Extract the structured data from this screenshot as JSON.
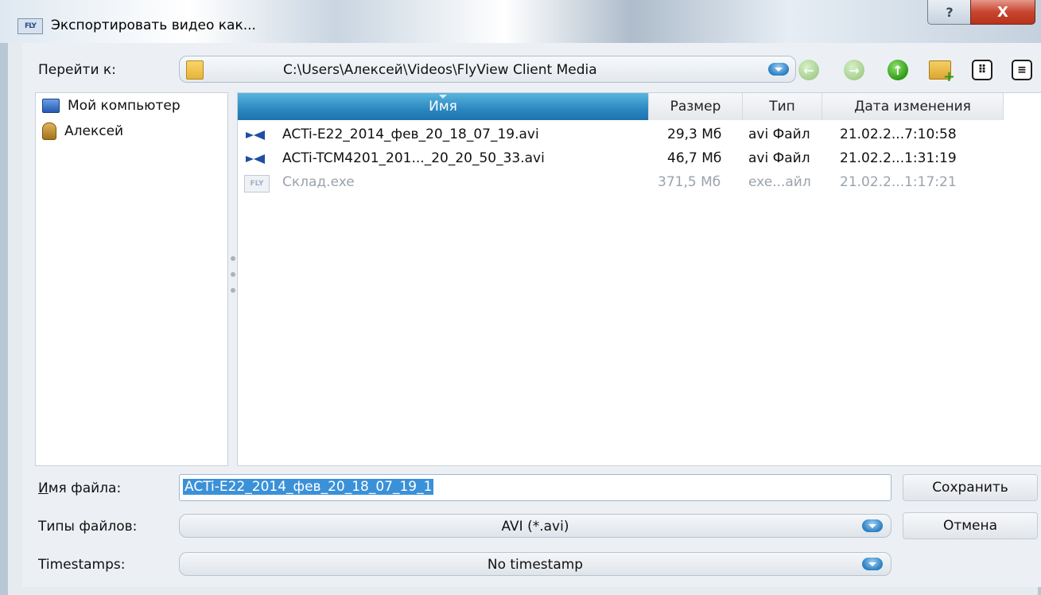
{
  "window": {
    "title": "Экспортировать видео как...",
    "logo_text": "FLY",
    "help_symbol": "?",
    "close_symbol": "X"
  },
  "navigation": {
    "goto_label": "Перейти к:",
    "path": "C:\\Users\\Алексей\\Videos\\FlyView Client Media",
    "back_icon": "←",
    "forward_icon": "→",
    "up_icon": "↑",
    "icon_view_symbol": "⠿",
    "detail_view_symbol": "≡"
  },
  "sidebar": {
    "items": [
      {
        "label": "Мой компьютер",
        "icon": "computer-icon"
      },
      {
        "label": "Алексей",
        "icon": "user-folder-icon"
      }
    ]
  },
  "filelist": {
    "columns": [
      "Имя",
      "Размер",
      "Тип",
      "Дата изменения"
    ],
    "sorted_column": "Имя",
    "rows": [
      {
        "name": "ACTi-E22_2014_фев_20_18_07_19.avi",
        "size": "29,3 Мб",
        "type": "avi Файл",
        "date": "21.02.2...7:10:58",
        "icon": "video-file-icon",
        "dim": false
      },
      {
        "name": "ACTi-TCM4201_201..._20_20_50_33.avi",
        "size": "46,7 Мб",
        "type": "avi Файл",
        "date": "21.02.2...1:31:19",
        "icon": "video-file-icon",
        "dim": false
      },
      {
        "name": "Склад.exe",
        "size": "371,5 Мб",
        "type": "exe...айл",
        "date": "21.02.2...1:17:21",
        "icon": "exe-file-icon",
        "dim": true
      }
    ]
  },
  "form": {
    "filename_label": "Имя файла:",
    "filename_value": "ACTi-E22_2014_фев_20_18_07_19_1",
    "filetype_label": "Типы файлов:",
    "filetype_value": "AVI (*.avi)",
    "timestamps_label": "Timestamps:",
    "timestamps_value": "No timestamp",
    "save_label": "Сохранить",
    "cancel_label": "Отмена"
  },
  "colors": {
    "accent": "#2b87c0",
    "close_red": "#c6462f",
    "selection": "#3b91d8"
  }
}
